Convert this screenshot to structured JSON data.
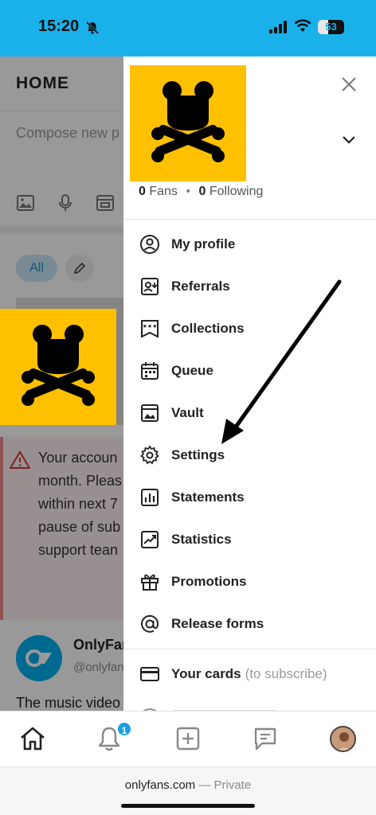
{
  "status_bar": {
    "time": "15:20",
    "battery": "53",
    "accent": "#1ab1eb"
  },
  "feed": {
    "title": "HOME",
    "compose_placeholder": "Compose new p",
    "filter_all": "All",
    "alert_lines": [
      "Your accoun",
      "month. Pleas",
      "within next 7",
      "pause of sub",
      "support tean"
    ],
    "author_name": "OnlyFans",
    "author_handle": "@onlyfan",
    "snippet": "The music video"
  },
  "drawer": {
    "fans_count": "0",
    "fans_label": "Fans",
    "following_count": "0",
    "following_label": "Following",
    "menu": [
      {
        "label": "My profile",
        "icon": "user-circle-icon"
      },
      {
        "label": "Referrals",
        "icon": "referral-icon"
      },
      {
        "label": "Collections",
        "icon": "collections-icon"
      },
      {
        "label": "Queue",
        "icon": "calendar-icon"
      },
      {
        "label": "Vault",
        "icon": "vault-icon"
      },
      {
        "label": "Settings",
        "icon": "gear-icon"
      },
      {
        "label": "Statements",
        "icon": "bar-chart-icon"
      },
      {
        "label": "Statistics",
        "icon": "line-chart-icon"
      },
      {
        "label": "Promotions",
        "icon": "gift-icon"
      },
      {
        "label": "Release forms",
        "icon": "at-sign-icon"
      }
    ],
    "cards": {
      "label": "Your cards",
      "sub": "(to subscribe)",
      "icon": "credit-card-icon"
    }
  },
  "tabbar": {
    "notification_badge": "1"
  },
  "browser": {
    "domain": "onlyfans.com",
    "mode": "— Private"
  },
  "colors": {
    "brand": "#00aff0",
    "logo_bg": "#ffc000"
  }
}
